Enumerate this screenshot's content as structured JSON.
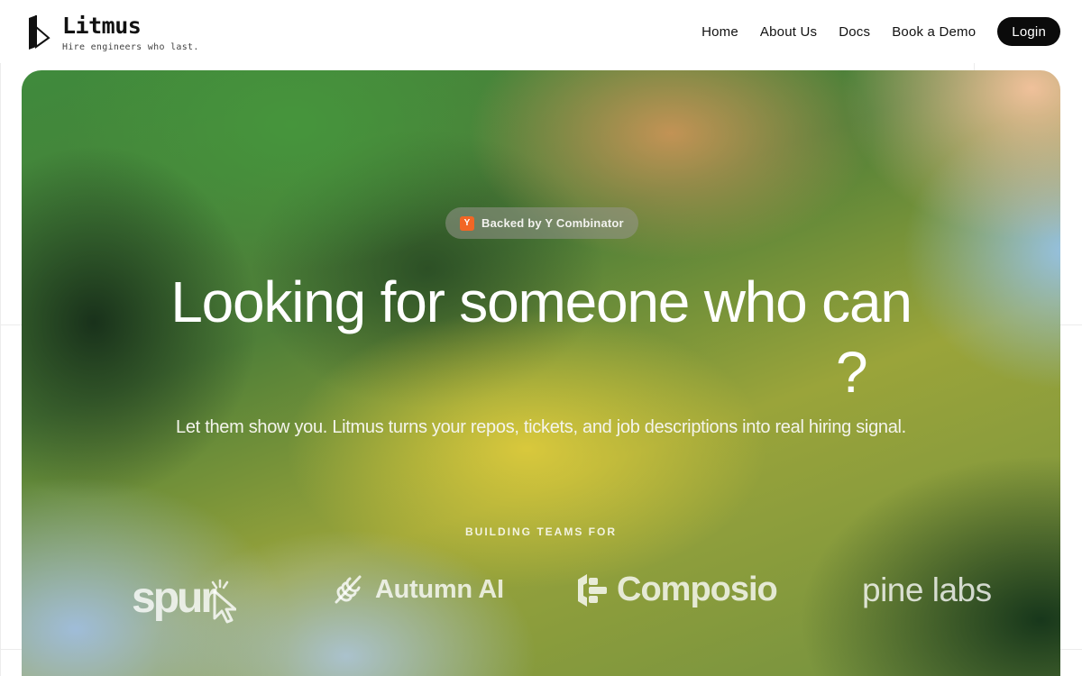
{
  "brand": {
    "name": "Litmus",
    "tagline": "Hire engineers who last."
  },
  "nav": {
    "items": [
      {
        "label": "Home"
      },
      {
        "label": "About Us"
      },
      {
        "label": "Docs"
      },
      {
        "label": "Book a Demo"
      }
    ],
    "login_label": "Login"
  },
  "hero": {
    "badge": {
      "icon_letter": "Y",
      "label": "Backed by Y Combinator",
      "icon_color": "#f26625"
    },
    "headline": "Looking for someone who can",
    "headline_end": "?",
    "subheadline": "Let them show you. Litmus turns your repos, tickets, and job descriptions into real hiring signal.",
    "teams_label": "BUILDING TEAMS FOR",
    "customer_logos": [
      {
        "name": "spur",
        "icon": "cursor-icon"
      },
      {
        "name": "Autumn AI",
        "icon": "leaf-icon"
      },
      {
        "name": "Composio",
        "icon": "composio-icon"
      },
      {
        "name": "pine labs",
        "icon": ""
      }
    ]
  },
  "colors": {
    "login_bg": "#0b0b0b",
    "badge_bg": "rgba(150,150,140,0.55)"
  }
}
